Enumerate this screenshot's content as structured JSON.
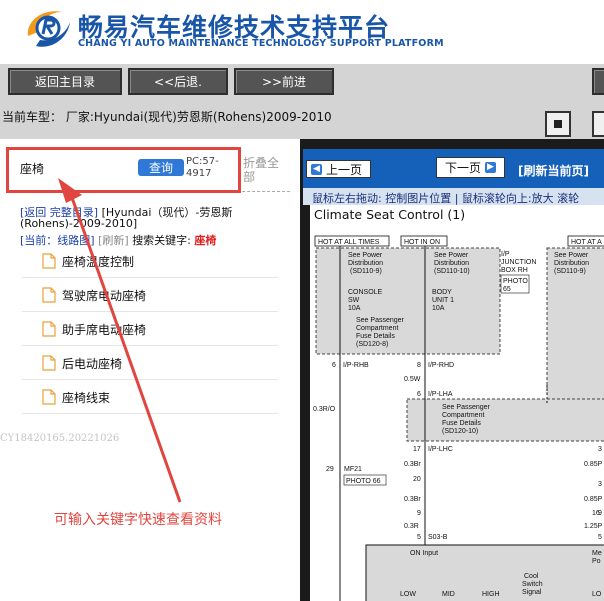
{
  "header": {
    "title_cn": "畅易汽车维修技术支持平台",
    "title_en": "CHANG YI AUTO MAINTENANCE TECHNOLOGY SUPPORT PLATFORM",
    "logo_icon": "cy-logo-icon"
  },
  "toolbar": {
    "home": "返回主目录",
    "back": "<<后退.",
    "forward": ">>前进"
  },
  "car": {
    "label": "当前车型：  厂家:Hyundai(现代)劳恩斯(Rohens)2009-2010"
  },
  "search": {
    "keyword": "座椅",
    "button": "查询",
    "pc_code": "PC:57-4917",
    "collapse": "折叠全部"
  },
  "breadcrumb": {
    "line1_link": "[返回 完整目录]",
    "line1_text": "[Hyundai（现代）-劳恩斯(Rohens)-2009-2010]",
    "line2_current": "[当前：线路图]",
    "line2_refresh": "[刷新]",
    "line2_label": "搜索关键字:",
    "line2_keyword": "座椅"
  },
  "tree": [
    {
      "label": "座椅温度控制"
    },
    {
      "label": "驾驶席电动座椅"
    },
    {
      "label": "助手席电动座椅"
    },
    {
      "label": "后电动座椅"
    },
    {
      "label": "座椅线束"
    }
  ],
  "footer_code": "CY18420165.20221026",
  "annotation": "可输入关键字快速查看资料",
  "viewer": {
    "prev": "上一页",
    "next": "下一页",
    "refresh": "[刷新当前页]",
    "hint": "鼠标左右拖动: 控制图片位置 | 鼠标滚轮向上:放大  滚轮",
    "diagram_title": "Climate Seat Control (1)"
  },
  "diagram": {
    "hot_all": "HOT AT ALL TIMES",
    "hot_in_on": "HOT IN ON",
    "hot_all_2": "HOT AT A",
    "see_power": "See Power",
    "distribution": "Distribution",
    "sd110_9": "(SD110-9)",
    "sd110_10": "(SD110-10)",
    "ip_junction": "I/P",
    "junction": "JUNCTION",
    "box_rh": "BOX RH",
    "photo": "PHOTO",
    "photo_num": "65",
    "console": "CONSOLE",
    "sw": "SW",
    "10a": "10A",
    "body": "BODY",
    "unit1": "UNIT 1",
    "see_passenger": "See Passenger",
    "compartment": "Compartment",
    "fuse_details": "Fuse Details",
    "sd120_8": "(SD120-8)",
    "sd120_10": "(SD120-10)",
    "pin6": "6",
    "ip_rhb": "I/P-RHB",
    "pin8": "8",
    "ip_rhd": "I/P-RHD",
    "w05": "0.5W",
    "ip_lha": "I/P-LHA",
    "w03r": "0.3R/O",
    "pin17": "17",
    "ip_lhc": "I/P-LHC",
    "w03br": "0.3Br",
    "pin29": "29",
    "mf21": "MF21",
    "photo66": "PHOTO 66",
    "pin20": "20",
    "pin9": "9",
    "w03r2": "0.3R",
    "pin5": "5",
    "s03b": "S03-B",
    "on_input": "ON Input",
    "cool": "Cool",
    "switch": "Switch",
    "signal": "Signal",
    "low": "LOW",
    "mid": "MID",
    "high": "HIGH",
    "me": "Me",
    "po": "Po",
    "lo": "LO",
    "r3": "3",
    "r085": "0.85P",
    "r3b": "3",
    "r085b": "0.85P",
    "r9": "9",
    "r16": "16",
    "r125": "1.25P",
    "r5": "5"
  }
}
